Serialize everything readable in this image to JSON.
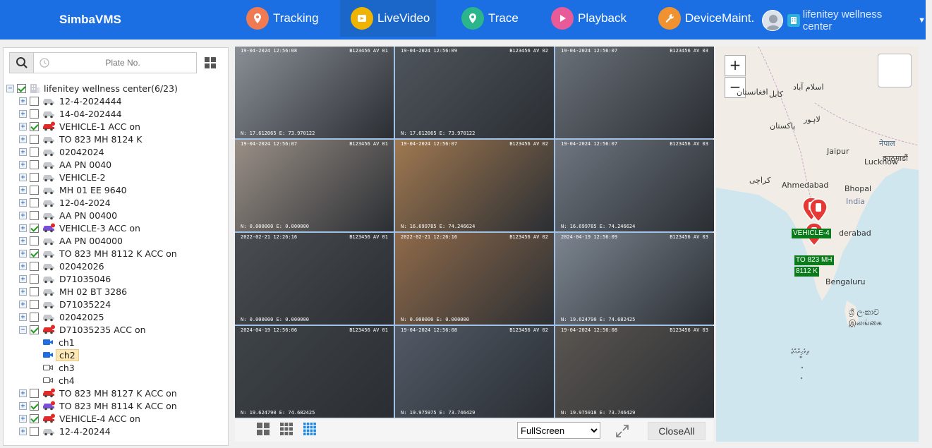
{
  "header": {
    "brand": "SimbaVMS",
    "tabs": [
      {
        "label": "Tracking",
        "icon": "tracking-icon",
        "color": "#f07a52"
      },
      {
        "label": "LiveVideo",
        "icon": "livevideo-icon",
        "color": "#f0b400"
      },
      {
        "label": "Trace",
        "icon": "trace-icon",
        "color": "#2bb58a"
      },
      {
        "label": "Playback",
        "icon": "playback-icon",
        "color": "#e85b98"
      },
      {
        "label": "DeviceMaint.",
        "icon": "wrench-icon",
        "color": "#f09230"
      }
    ],
    "active_tab": "LiveVideo",
    "user": "lifenitey wellness center"
  },
  "sidebar": {
    "search_placeholder": "Plate No.",
    "root": "lifenitey wellness center(6/23)",
    "vehicles": [
      {
        "label": "12-4-2024444",
        "checked": false,
        "online": false
      },
      {
        "label": "14-04-202444",
        "checked": false,
        "online": false
      },
      {
        "label": "VEHICLE-1 ACC on",
        "checked": true,
        "online": true,
        "color": "#e02a2a"
      },
      {
        "label": "TO 823 MH 8124 K",
        "checked": false,
        "online": false
      },
      {
        "label": "02042024",
        "checked": false,
        "online": false
      },
      {
        "label": "AA PN 0040",
        "checked": false,
        "online": false
      },
      {
        "label": "VEHICLE-2",
        "checked": false,
        "online": false
      },
      {
        "label": "MH 01 EE 9640",
        "checked": false,
        "online": false
      },
      {
        "label": "12-04-2024",
        "checked": false,
        "online": false
      },
      {
        "label": "AA PN 00400",
        "checked": false,
        "online": false
      },
      {
        "label": "VEHICLE-3 ACC on",
        "checked": true,
        "online": true,
        "color": "#7a4fd6"
      },
      {
        "label": "AA PN 004000",
        "checked": false,
        "online": false
      },
      {
        "label": "TO 823 MH 8112 K ACC on",
        "checked": true,
        "online": false
      },
      {
        "label": "02042026",
        "checked": false,
        "online": false
      },
      {
        "label": "D71035046",
        "checked": false,
        "online": false
      },
      {
        "label": "MH 02 BT 3286",
        "checked": false,
        "online": false
      },
      {
        "label": "D71035224",
        "checked": false,
        "online": false
      },
      {
        "label": "02042025",
        "checked": false,
        "online": false
      },
      {
        "label": "D71035235 ACC on",
        "checked": true,
        "online": true,
        "color": "#e02a2a",
        "expanded": true
      }
    ],
    "channels": [
      {
        "label": "ch1",
        "active": true,
        "selected": false
      },
      {
        "label": "ch2",
        "active": true,
        "selected": true
      },
      {
        "label": "ch3",
        "active": false,
        "selected": false
      },
      {
        "label": "ch4",
        "active": false,
        "selected": false
      }
    ],
    "vehicles_after": [
      {
        "label": "TO 823 MH 8127 K ACC on",
        "checked": false,
        "online": true,
        "color": "#e02a2a"
      },
      {
        "label": "TO 823 MH 8114 K ACC on",
        "checked": true,
        "online": true,
        "color": "#7a4fd6"
      },
      {
        "label": "VEHICLE-4 ACC on",
        "checked": true,
        "online": true,
        "color": "#e02a2a"
      },
      {
        "label": "12-4-20244",
        "checked": false,
        "online": false
      }
    ]
  },
  "video": {
    "cells": [
      {
        "ts": "19-04-2024  12:56:08",
        "ch": "B123456  AV  01",
        "gps": "N: 17.612065  E: 73.970122",
        "bg": "#8a8f96"
      },
      {
        "ts": "19-04-2024  12:56:09",
        "ch": "B123456  AV  02",
        "gps": "N: 17.612065  E: 73.970122",
        "bg": "#4f555c"
      },
      {
        "ts": "19-04-2024  12:56:07",
        "ch": "B123456  AV  03",
        "gps": "",
        "bg": "#6a7078"
      },
      {
        "ts": "19-04-2024  12:56:07",
        "ch": "B123456  AV  01",
        "gps": "N: 0.000000  E: 0.000000",
        "bg": "#9a8f86"
      },
      {
        "ts": "19-04-2024  12:56:07",
        "ch": "B123456  AV  02",
        "gps": "N: 16.699785  E: 74.246624",
        "bg": "#a07850"
      },
      {
        "ts": "19-04-2024  12:56:07",
        "ch": "B123456  AV  03",
        "gps": "N: 16.699785  E: 74.246624",
        "bg": "#6f7680"
      },
      {
        "ts": "2022-02-21  12:26:16",
        "ch": "B123456  AV  01",
        "gps": "N: 0.000000  E: 0.000000",
        "bg": "#4a4e53"
      },
      {
        "ts": "2022-02-21  12:26:16",
        "ch": "B123456  AV  02",
        "gps": "N: 0.000000  E: 0.000000",
        "bg": "#8f6a4a"
      },
      {
        "ts": "2024-04-19  12:56:09",
        "ch": "B123456  AV  03",
        "gps": "N: 19.624790  E: 74.682425",
        "bg": "#7c8590"
      },
      {
        "ts": "2024-04-19  12:56:06",
        "ch": "B123456  AV  01",
        "gps": "N: 19.624790  E: 74.682425",
        "bg": "#3f4449"
      },
      {
        "ts": "19-04-2024  12:56:08",
        "ch": "B123456  AV  02",
        "gps": "N: 19.975975  E: 73.746429",
        "bg": "#525a66"
      },
      {
        "ts": "19-04-2024  12:56:08",
        "ch": "B123456  AV  03",
        "gps": "N: 19.975918  E: 73.746429",
        "bg": "#5a5550"
      }
    ],
    "fullscreen_option": "FullScreen",
    "closeall_label": "CloseAll"
  },
  "map": {
    "zoom_in": "+",
    "zoom_out": "−",
    "labels": [
      {
        "text": "اسلام آباد",
        "id": "islamabad"
      },
      {
        "text": "کابل",
        "id": "kabul"
      },
      {
        "text": "افغانستان",
        "id": "afghanistan"
      },
      {
        "text": "لاہور",
        "id": "lahore"
      },
      {
        "text": "پاکستان",
        "id": "pakistan"
      },
      {
        "text": "नेपाल",
        "id": "nepal"
      },
      {
        "text": "काठमाडौं",
        "id": "kathmandu"
      },
      {
        "text": "Jaipur",
        "id": "jaipur"
      },
      {
        "text": "Lucknow",
        "id": "lucknow"
      },
      {
        "text": "کراچی",
        "id": "karachi"
      },
      {
        "text": "Ahmedabad",
        "id": "ahmedabad"
      },
      {
        "text": "Bhopal",
        "id": "bhopal"
      },
      {
        "text": "India",
        "id": "india"
      },
      {
        "text": "derabad",
        "id": "hyderabad"
      },
      {
        "text": "Bengaluru",
        "id": "bengaluru"
      },
      {
        "text": "ශ්‍රී ලංකාව",
        "id": "srilanka1"
      },
      {
        "text": "இலங்கை",
        "id": "srilanka2"
      },
      {
        "text": "ދިވެހިރާއްޖެ",
        "id": "maldives"
      }
    ],
    "vehicle_tags": [
      {
        "text": "VEHICLE-4"
      },
      {
        "text": "TO 823 MH"
      },
      {
        "text": "8112 K"
      }
    ]
  }
}
